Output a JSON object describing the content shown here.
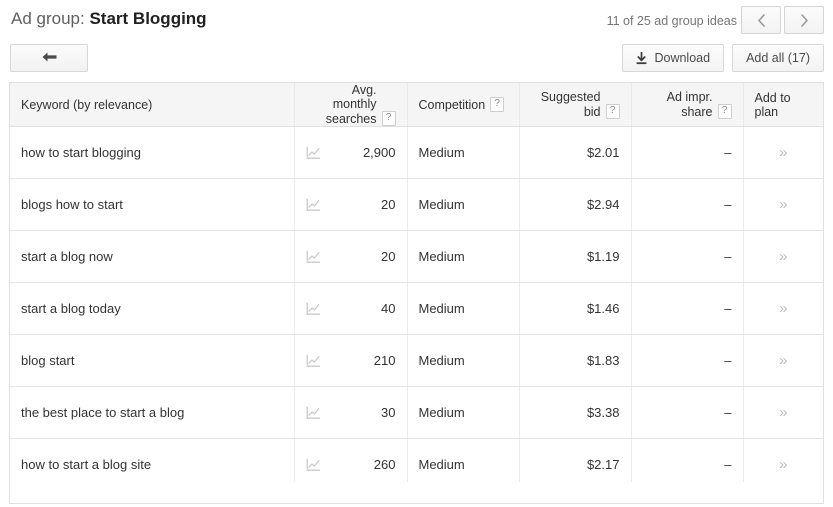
{
  "header": {
    "ad_group_label": "Ad group:",
    "ad_group_name": "Start Blogging",
    "idea_count": "11 of 25 ad group ideas",
    "prev_icon": "chevron-left-icon",
    "next_icon": "chevron-right-icon",
    "back_icon": "back-arrow-icon",
    "download_label": "Download",
    "download_icon": "download-icon",
    "add_all_label": "Add all (17)"
  },
  "table": {
    "columns": [
      {
        "label": "Keyword (by relevance)",
        "help": false
      },
      {
        "label_line1": "Avg. monthly",
        "label_line2": "searches",
        "help": true
      },
      {
        "label": "Competition",
        "help": true
      },
      {
        "label": "Suggested bid",
        "help": true
      },
      {
        "label": "Ad impr. share",
        "help": true
      },
      {
        "label": "Add to plan",
        "help": false
      }
    ],
    "rows": [
      {
        "keyword": "how to start blogging",
        "searches": "2,900",
        "competition": "Medium",
        "bid": "$2.01",
        "impr_share": "–",
        "add_icon": "double-chevron-right-icon"
      },
      {
        "keyword": "blogs how to start",
        "searches": "20",
        "competition": "Medium",
        "bid": "$2.94",
        "impr_share": "–",
        "add_icon": "double-chevron-right-icon"
      },
      {
        "keyword": "start a blog now",
        "searches": "20",
        "competition": "Medium",
        "bid": "$1.19",
        "impr_share": "–",
        "add_icon": "double-chevron-right-icon"
      },
      {
        "keyword": "start a blog today",
        "searches": "40",
        "competition": "Medium",
        "bid": "$1.46",
        "impr_share": "–",
        "add_icon": "double-chevron-right-icon"
      },
      {
        "keyword": "blog start",
        "searches": "210",
        "competition": "Medium",
        "bid": "$1.83",
        "impr_share": "–",
        "add_icon": "double-chevron-right-icon"
      },
      {
        "keyword": "the best place to start a blog",
        "searches": "30",
        "competition": "Medium",
        "bid": "$3.38",
        "impr_share": "–",
        "add_icon": "double-chevron-right-icon"
      },
      {
        "keyword": "how to start a blog site",
        "searches": "260",
        "competition": "Medium",
        "bid": "$2.17",
        "impr_share": "–",
        "add_icon": "double-chevron-right-icon"
      }
    ],
    "trend_icon": "line-chart-icon",
    "help_glyph": "?"
  },
  "colors": {
    "page_bg": "#ffffff",
    "header_bg": "#f5f5f5",
    "border": "#e0e0e0",
    "text": "#333333",
    "muted": "#757575"
  }
}
